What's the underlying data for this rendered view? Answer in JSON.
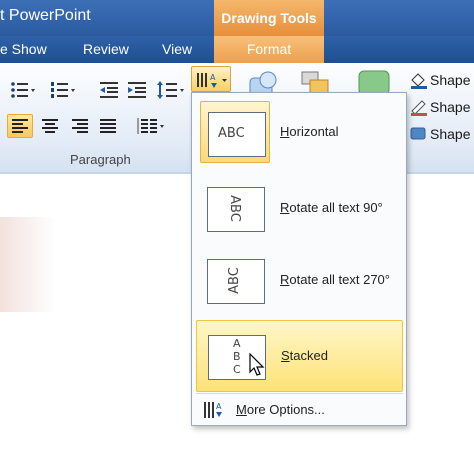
{
  "title_bar": {
    "app_title": "t PowerPoint",
    "contextual_title": "Drawing Tools"
  },
  "tabs": {
    "slide_show": "e Show",
    "review": "Review",
    "view": "View",
    "format": "Format"
  },
  "ribbon": {
    "group_label": "Paragraph",
    "shape_commands": [
      "Shape",
      "Shape",
      "Shape"
    ]
  },
  "text_direction_menu": {
    "items": [
      {
        "label_hotkey": "H",
        "label_rest": "orizontal",
        "preview": "ABC"
      },
      {
        "label_hotkey": "R",
        "label_rest": "otate all text 90°",
        "preview": "ABC"
      },
      {
        "label_hotkey": "R",
        "label_rest": "otate all text 270°",
        "preview": "ABC"
      },
      {
        "label_hotkey": "S",
        "label_rest": "tacked",
        "preview_letters": [
          "A",
          "B",
          "C"
        ]
      }
    ],
    "more_options": {
      "label_hotkey": "M",
      "label_rest": "ore Options..."
    }
  },
  "colors": {
    "title_bar": "#2b5a9e",
    "contextual_tab": "#e78e3b",
    "highlight": "#fde98a",
    "highlight_border": "#f0c64a"
  }
}
